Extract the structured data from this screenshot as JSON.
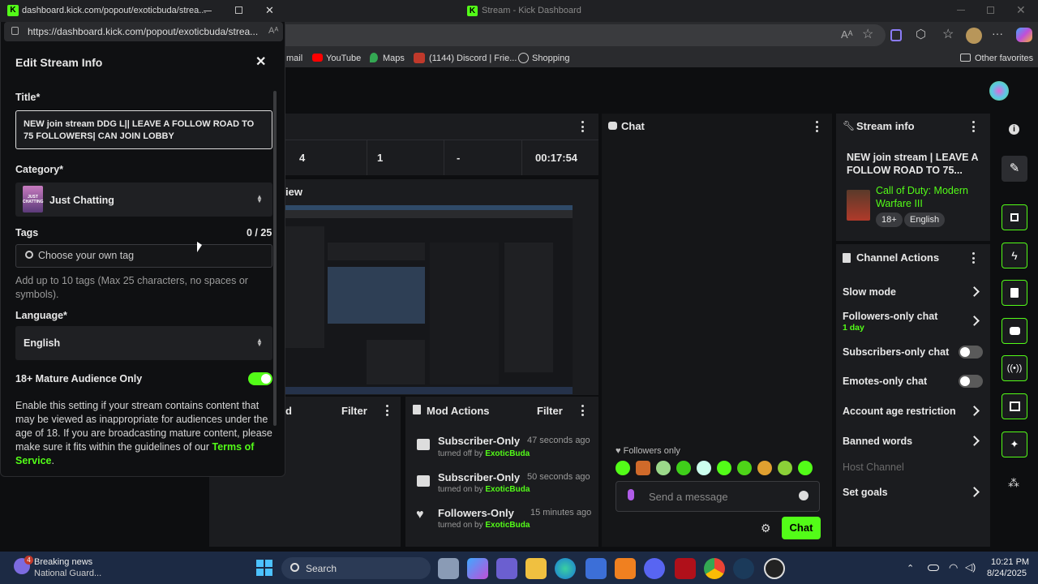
{
  "browser": {
    "window_title": "Stream - Kick Dashboard",
    "bookmarks": [
      "mail",
      "YouTube",
      "Maps",
      "(1144) Discord | Frie...",
      "Shopping"
    ],
    "other_favorites": "Other favorites"
  },
  "popup": {
    "window_title": "dashboard.kick.com/popout/exoticbuda/strea...",
    "url": "https://dashboard.kick.com/popout/exoticbuda/strea...",
    "heading": "Edit Stream Info",
    "title_label": "Title*",
    "title_value": "NEW join stream   DDG L|| LEAVE A FOLLOW ROAD TO 75 FOLLOWERS| CAN JOIN LOBBY",
    "category_label": "Category*",
    "category_value": "Just Chatting",
    "category_thumb_text": "JUST CHATTING",
    "tags_label": "Tags",
    "tags_count": "0 / 25",
    "tags_placeholder": "Choose your own tag",
    "tags_help": "Add up to 10 tags (Max 25 characters, no spaces or symbols).",
    "language_label": "Language*",
    "language_value": "English",
    "mature_label": "18+ Mature Audience Only",
    "mature_on": true,
    "mature_help": "Enable this setting if your stream contains content that may be viewed as inappropriate for audiences under the age of 18. If you are broadcasting mature content, please make sure it fits within the guidelines of our",
    "terms_link": "Terms of Service",
    "terms_period": "."
  },
  "stats": {
    "values": [
      "4",
      "1",
      "-",
      "00:17:54"
    ]
  },
  "preview": {
    "label": "iew"
  },
  "left_lower": {
    "label": "d",
    "filter": "Filter"
  },
  "mod_actions": {
    "title": "Mod Actions",
    "filter": "Filter",
    "items": [
      {
        "title": "Subscriber-Only",
        "action": "turned off by",
        "user": "ExoticBuda",
        "time": "47 seconds ago"
      },
      {
        "title": "Subscriber-Only",
        "action": "turned on by",
        "user": "ExoticBuda",
        "time": "50 seconds ago"
      },
      {
        "title": "Followers-Only",
        "action": "turned on by",
        "user": "ExoticBuda",
        "time": "15 minutes ago"
      }
    ]
  },
  "chat": {
    "title": "Chat",
    "followers_only": "Followers only",
    "placeholder": "Send a message",
    "send": "Chat"
  },
  "stream_info": {
    "title": "Stream info",
    "stream_title": "NEW join stream | LEAVE A FOLLOW ROAD TO 75...",
    "category": "Call of Duty: Modern Warfare III",
    "badges": [
      "18+",
      "English"
    ]
  },
  "channel_actions": {
    "title": "Channel Actions",
    "slow_mode": "Slow mode",
    "followers_only": "Followers-only chat",
    "followers_sub": "1 day",
    "subscribers_only": "Subscribers-only chat",
    "emotes_only": "Emotes-only chat",
    "account_age": "Account age restriction",
    "banned_words": "Banned words",
    "host_channel": "Host Channel",
    "set_goals": "Set goals",
    "subscribers_on": false,
    "emotes_on": false
  },
  "taskbar": {
    "news_title": "Breaking news",
    "news_sub": "National Guard...",
    "news_badge": "4",
    "search": "Search",
    "time": "10:21 PM",
    "date": "8/24/2025"
  },
  "colors": {
    "accent": "#53fc18",
    "bg": "#0d0e10",
    "panel": "#1b1c1f"
  }
}
